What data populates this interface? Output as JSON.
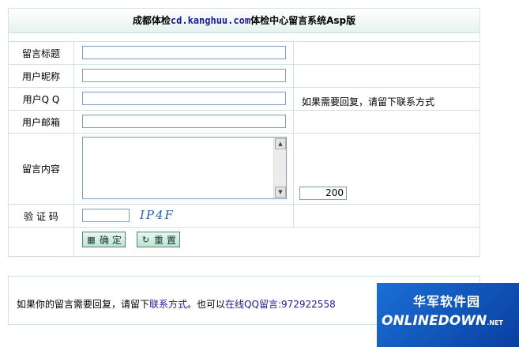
{
  "header": {
    "title_prefix": "成都体检",
    "title_url": "cd.kanghuu.com",
    "title_suffix": "体检中心留言系统Asp版"
  },
  "form": {
    "fields": [
      {
        "label": "留言标题",
        "value": ""
      },
      {
        "label": "用户昵称",
        "value": ""
      },
      {
        "label": "用户Q Q",
        "value": "",
        "hint": "如果需要回复，请留下联系方式"
      },
      {
        "label": "用户邮箱",
        "value": ""
      }
    ],
    "content": {
      "label": "留言内容",
      "value": "",
      "counter": "200"
    },
    "captcha": {
      "label": "验 证 码",
      "value": "",
      "code": "IP4F"
    },
    "buttons": {
      "submit": "确 定",
      "reset": "重 置"
    }
  },
  "notice": {
    "text_before": "如果你的留言需要回复，请留下",
    "link1": "联系方式",
    "text_middle": "。也可以",
    "link2": "在线QQ留言",
    "qq": ":972922558"
  },
  "watermark": {
    "cn": "华军软件园",
    "en": "ONLINEDOWN",
    "suffix": ".NET"
  }
}
